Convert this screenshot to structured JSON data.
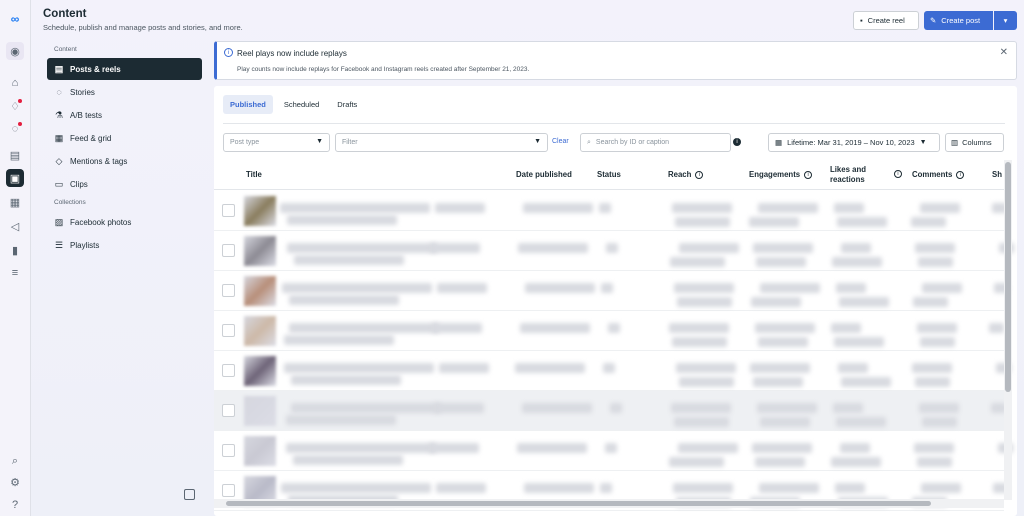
{
  "header": {
    "title": "Content",
    "subtitle": "Schedule, publish and manage posts and stories, and more."
  },
  "actions": {
    "create_reel": "Create reel",
    "create_post": "Create post"
  },
  "rail": [
    "meta-logo-icon",
    "profile-icon",
    "home-icon",
    "notifications-icon",
    "activity-icon",
    "contact-card-icon",
    "content-icon",
    "planner-icon",
    "ads-icon",
    "insights-icon",
    "menu-icon",
    "search-icon",
    "settings-icon",
    "help-icon"
  ],
  "nav": {
    "content_label": "Content",
    "items": [
      {
        "label": "Posts & reels",
        "icon": "posts-icon"
      },
      {
        "label": "Stories",
        "icon": "stories-icon"
      },
      {
        "label": "A/B tests",
        "icon": "flask-icon"
      },
      {
        "label": "Feed & grid",
        "icon": "grid-icon"
      },
      {
        "label": "Mentions & tags",
        "icon": "tag-icon"
      },
      {
        "label": "Clips",
        "icon": "clips-icon"
      }
    ],
    "collections_label": "Collections",
    "collections": [
      {
        "label": "Facebook photos",
        "icon": "photo-icon"
      },
      {
        "label": "Playlists",
        "icon": "playlist-icon"
      }
    ]
  },
  "banner": {
    "title": "Reel plays now include replays",
    "body": "Play counts now include replays for Facebook and Instagram reels created after September 21, 2023."
  },
  "tabs": [
    "Published",
    "Scheduled",
    "Drafts"
  ],
  "filters": {
    "post_type_placeholder": "Post type",
    "filter_placeholder": "Filter",
    "clear": "Clear",
    "search_placeholder": "Search by ID or caption",
    "date_range": "Lifetime: Mar 31, 2019 – Nov 10, 2023",
    "columns": "Columns"
  },
  "table": {
    "headers": {
      "title": "Title",
      "date": "Date published",
      "status": "Status",
      "reach": "Reach",
      "engagements": "Engagements",
      "likes": "Likes and reactions",
      "comments": "Comments",
      "shares": "Sh"
    },
    "row_count": 8
  }
}
